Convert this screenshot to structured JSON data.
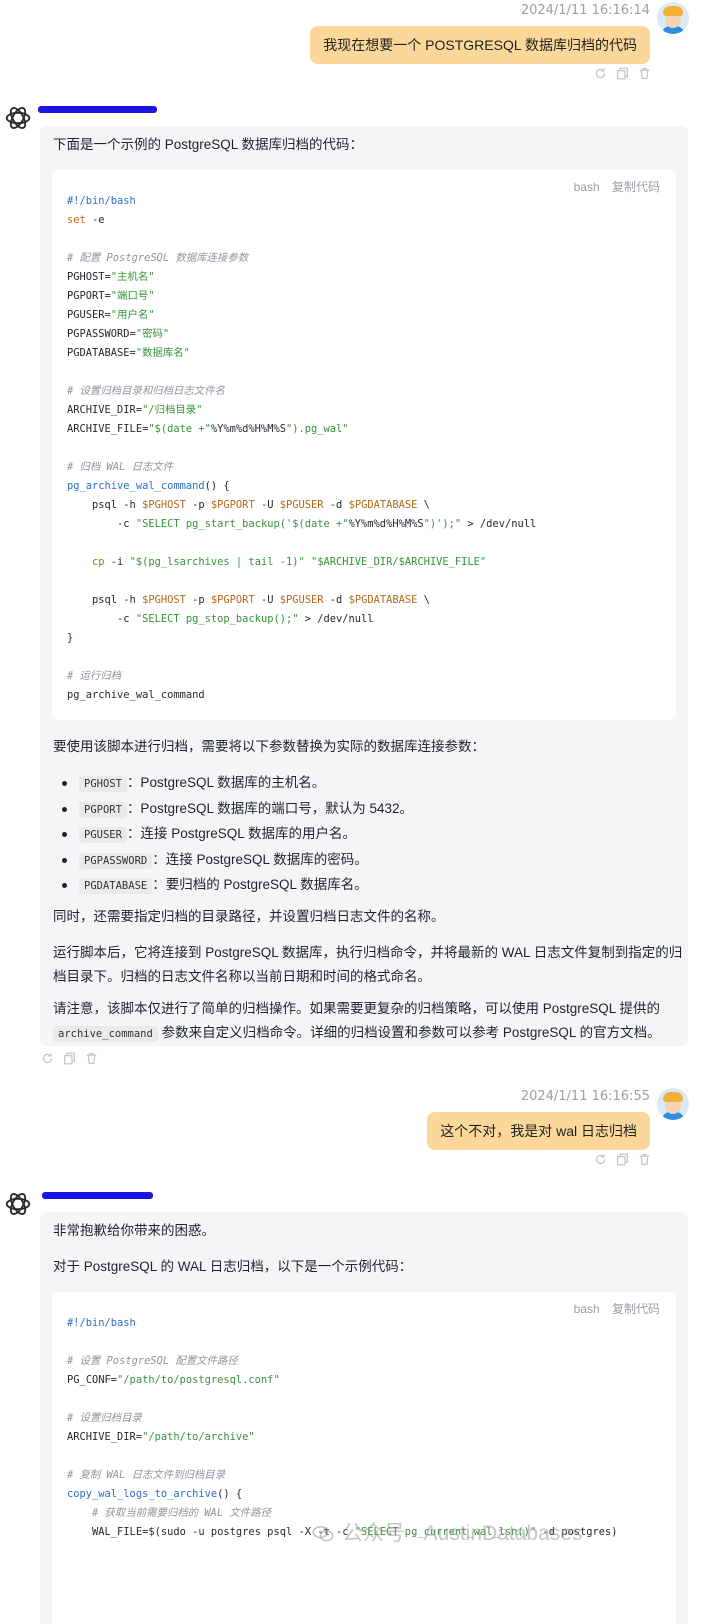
{
  "messages": [
    {
      "role": "user",
      "timestamp": "2024/1/11 16:16:14",
      "text": "我现在想要一个 POSTGRESQL 数据库归档的代码"
    },
    {
      "role": "assistant",
      "intro": "下面是一个示例的 PostgreSQL 数据库归档的代码：",
      "code_lang": "bash",
      "copy_label": "复制代码",
      "code": [
        "#!/bin/bash",
        "set -e",
        "",
        "# 配置 PostgreSQL 数据库连接参数",
        "PGHOST=\"主机名\"",
        "PGPORT=\"端口号\"",
        "PGUSER=\"用户名\"",
        "PGPASSWORD=\"密码\"",
        "PGDATABASE=\"数据库名\"",
        "",
        "# 设置归档目录和归档日志文件名",
        "ARCHIVE_DIR=\"/归档目录\"",
        "ARCHIVE_FILE=\"$(date +\"%Y%m%d%H%M%S\").pg_wal\"",
        "",
        "# 归档 WAL 日志文件",
        "pg_archive_wal_command() {",
        "    psql -h $PGHOST -p $PGPORT -U $PGUSER -d $PGDATABASE \\",
        "        -c \"SELECT pg_start_backup('$(date +\"%Y%m%d%H%M%S\")');\" > /dev/null",
        "",
        "    cp -i \"$(pg_lsarchives | tail -1)\" \"$ARCHIVE_DIR/$ARCHIVE_FILE\"",
        "",
        "    psql -h $PGHOST -p $PGPORT -U $PGUSER -d $PGDATABASE \\",
        "        -c \"SELECT pg_stop_backup();\" > /dev/null",
        "}",
        "",
        "# 运行归档",
        "pg_archive_wal_command"
      ],
      "params_intro": "要使用该脚本进行归档，需要将以下参数替换为实际的数据库连接参数：",
      "params": [
        {
          "code": "PGHOST",
          "desc": "：PostgreSQL 数据库的主机名。"
        },
        {
          "code": "PGPORT",
          "desc": "：PostgreSQL 数据库的端口号，默认为 5432。"
        },
        {
          "code": "PGUSER",
          "desc": "：连接 PostgreSQL 数据库的用户名。"
        },
        {
          "code": "PGPASSWORD",
          "desc": "：连接 PostgreSQL 数据库的密码。"
        },
        {
          "code": "PGDATABASE",
          "desc": "：要归档的 PostgreSQL 数据库名。"
        }
      ],
      "para1": "同时，还需要指定归档的目录路径，并设置归档日志文件的名称。",
      "para2_line1": "运行脚本后，它将连接到 PostgreSQL 数据库，执行归档命令，并将最新的 WAL 日志文件复制到指定的归",
      "para2_line2": "档目录下。归档的日志文件名称以当前日期和时间的格式命名。",
      "para3_line1": "请注意，该脚本仅进行了简单的归档操作。如果需要更复杂的归档策略，可以使用 PostgreSQL 提供的",
      "para3_code": "archive_command",
      "para3_rest": " 参数来自定义归档命令。详细的归档设置和参数可以参考 PostgreSQL 的官方文档。"
    },
    {
      "role": "user",
      "timestamp": "2024/1/11 16:16:55",
      "text": "这个不对，我是对 wal 日志归档"
    },
    {
      "role": "assistant",
      "line1": "非常抱歉给你带来的困惑。",
      "line2": "对于 PostgreSQL 的 WAL 日志归档，以下是一个示例代码：",
      "code_lang": "bash",
      "copy_label": "复制代码",
      "code": [
        "#!/bin/bash",
        "",
        "# 设置 PostgreSQL 配置文件路径",
        "PG_CONF=\"/path/to/postgresql.conf\"",
        "",
        "# 设置归档目录",
        "ARCHIVE_DIR=\"/path/to/archive\"",
        "",
        "# 复制 WAL 日志文件到归档目录",
        "copy_wal_logs_to_archive() {",
        "    # 获取当前需要归档的 WAL 文件路径",
        "    WAL_FILE=$(sudo -u postgres psql -X -t -c \"SELECT pg_current_wal_lsn()\" -d postgres)"
      ]
    }
  ],
  "watermark": "公众号 · AustinDatabases",
  "icons": [
    "refresh-icon",
    "copy-icon",
    "trash-icon",
    "openai-logo-icon",
    "user-avatar-icon",
    "wechat-icon"
  ]
}
